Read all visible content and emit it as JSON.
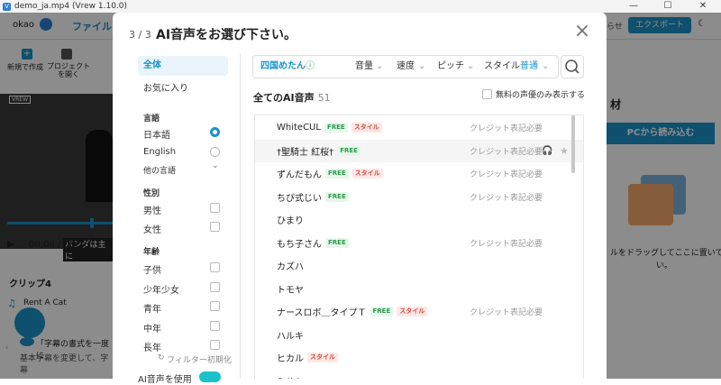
{
  "window": {
    "title": "demo_ja.mp4 (Vrew 1.10.0)",
    "app_icon": "V",
    "minimize": "—",
    "maximize": "☐",
    "close": "✕"
  },
  "app": {
    "user": "okao",
    "file_tab": "ファイル",
    "new_label": "新規で作成",
    "open_label": "プロジェクト\nを開く",
    "right_partial": "らせ",
    "export_label": "エクスポート",
    "material_partial": "材",
    "pc_load": "PCから読み込む",
    "drop_partial": "ルをドラッグしてここに置いて\nい。",
    "video_logo": "VREW",
    "subtitle_partial": "パンダは主に",
    "time_current": "00:06",
    "time_total": "/ 00:16",
    "clip_label": "クリップ4",
    "clip_music": "Rent A Cat",
    "tip_title": "「字幕の書式を一度に",
    "tip_body": "基本字幕を変更して、字幕"
  },
  "modal": {
    "step": "3 / 3",
    "title": "AI音声をお選び下さい。",
    "filters": {
      "all": "全体",
      "favorites": "お気に入り",
      "language_head": "言語",
      "languages": [
        "日本語",
        "English"
      ],
      "other_lang": "他の言語",
      "gender_head": "性別",
      "genders": [
        "男性",
        "女性"
      ],
      "age_head": "年齢",
      "ages": [
        "子供",
        "少年少女",
        "青年",
        "中年",
        "長年"
      ],
      "reset": "フィルター初期化",
      "ai_voice_toggle": "AI音声を使用"
    },
    "topbar": {
      "selected_voice": "四国めたん",
      "volume": "音量",
      "speed": "速度",
      "pitch": "ピッチ",
      "style_label": "スタイル",
      "style_value": "普通"
    },
    "list": {
      "header": "全てのAI音声",
      "count": "51",
      "free_only": "無料の声優のみ表示する",
      "badge_free": "FREE",
      "badge_style": "スタイル",
      "credit_text": "クレジット表記必要",
      "rows": [
        {
          "name": "WhiteCUL",
          "free": true,
          "style": true,
          "credit": true
        },
        {
          "name": "†聖騎士 紅桜†",
          "free": true,
          "style": false,
          "credit": true
        },
        {
          "name": "ずんだもん",
          "free": true,
          "style": true,
          "credit": true
        },
        {
          "name": "ちび式じい",
          "free": true,
          "style": false,
          "credit": true
        },
        {
          "name": "ひまり",
          "free": false,
          "style": false,
          "credit": false
        },
        {
          "name": "もち子さん",
          "free": true,
          "style": false,
          "credit": true
        },
        {
          "name": "カズハ",
          "free": false,
          "style": false,
          "credit": false
        },
        {
          "name": "トモヤ",
          "free": false,
          "style": false,
          "credit": false
        },
        {
          "name": "ナースロボ＿タイプＴ",
          "free": true,
          "style": true,
          "credit": true
        },
        {
          "name": "ハルキ",
          "free": false,
          "style": false,
          "credit": false
        },
        {
          "name": "ヒカル",
          "free": false,
          "style": true,
          "credit": false
        },
        {
          "name": "ミサト",
          "free": false,
          "style": false,
          "credit": false
        }
      ]
    }
  }
}
